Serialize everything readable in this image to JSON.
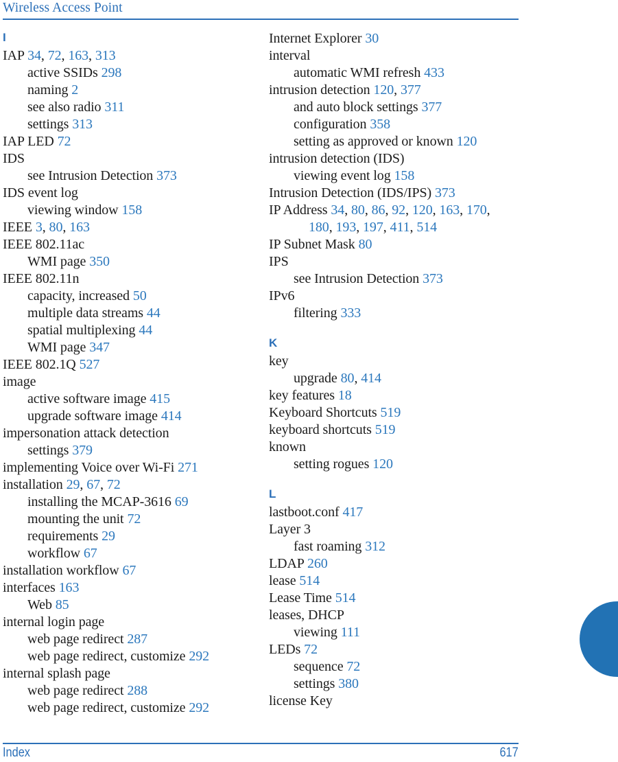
{
  "header": {
    "title": "Wireless Access Point"
  },
  "footer": {
    "label": "Index",
    "page_number": "617"
  },
  "colors": {
    "accent": "#2c70b8",
    "page_number": "#2c78bd",
    "body_text": "#1c1c1c",
    "thumb_tab": "#2272b4"
  },
  "columns": [
    {
      "name": "left-column",
      "sections": [
        {
          "letter": "I",
          "first": true,
          "entries": [
            {
              "level": 0,
              "text": "IAP",
              "pages": [
                "34",
                "72",
                "163",
                "313"
              ]
            },
            {
              "level": 1,
              "text": "active SSIDs",
              "pages": [
                "298"
              ]
            },
            {
              "level": 1,
              "text": "naming",
              "pages": [
                "2"
              ]
            },
            {
              "level": 1,
              "text": "see also radio",
              "pages": [
                "311"
              ]
            },
            {
              "level": 1,
              "text": "settings",
              "pages": [
                "313"
              ]
            },
            {
              "level": 0,
              "text": "IAP LED",
              "pages": [
                "72"
              ]
            },
            {
              "level": 0,
              "text": "IDS",
              "pages": []
            },
            {
              "level": 1,
              "text": "see Intrusion Detection",
              "pages": [
                "373"
              ]
            },
            {
              "level": 0,
              "text": "IDS event log",
              "pages": []
            },
            {
              "level": 1,
              "text": "viewing window",
              "pages": [
                "158"
              ]
            },
            {
              "level": 0,
              "text": "IEEE",
              "pages": [
                "3",
                "80",
                "163"
              ]
            },
            {
              "level": 0,
              "text": "IEEE 802.11ac",
              "pages": []
            },
            {
              "level": 1,
              "text": "WMI page",
              "pages": [
                "350"
              ]
            },
            {
              "level": 0,
              "text": "IEEE 802.11n",
              "pages": []
            },
            {
              "level": 1,
              "text": "capacity, increased",
              "pages": [
                "50"
              ]
            },
            {
              "level": 1,
              "text": "multiple data streams",
              "pages": [
                "44"
              ]
            },
            {
              "level": 1,
              "text": "spatial multiplexing",
              "pages": [
                "44"
              ]
            },
            {
              "level": 1,
              "text": "WMI page",
              "pages": [
                "347"
              ]
            },
            {
              "level": 0,
              "text": "IEEE 802.1Q",
              "pages": [
                "527"
              ]
            },
            {
              "level": 0,
              "text": "image",
              "pages": []
            },
            {
              "level": 1,
              "text": "active software image",
              "pages": [
                "415"
              ]
            },
            {
              "level": 1,
              "text": "upgrade software image",
              "pages": [
                "414"
              ]
            },
            {
              "level": 0,
              "text": "impersonation attack detection",
              "pages": []
            },
            {
              "level": 1,
              "text": "settings",
              "pages": [
                "379"
              ]
            },
            {
              "level": 0,
              "text": "implementing Voice over Wi-Fi",
              "pages": [
                "271"
              ]
            },
            {
              "level": 0,
              "text": "installation",
              "pages": [
                "29",
                "67",
                "72"
              ]
            },
            {
              "level": 1,
              "text": "installing the MCAP-3616",
              "pages": [
                "69"
              ]
            },
            {
              "level": 1,
              "text": "mounting the unit",
              "pages": [
                "72"
              ]
            },
            {
              "level": 1,
              "text": "requirements",
              "pages": [
                "29"
              ]
            },
            {
              "level": 1,
              "text": "workflow",
              "pages": [
                "67"
              ]
            },
            {
              "level": 0,
              "text": "installation workflow",
              "pages": [
                "67"
              ]
            },
            {
              "level": 0,
              "text": "interfaces",
              "pages": [
                "163"
              ]
            },
            {
              "level": 1,
              "text": "Web",
              "pages": [
                "85"
              ]
            },
            {
              "level": 0,
              "text": "internal login page",
              "pages": []
            },
            {
              "level": 1,
              "text": "web page redirect",
              "pages": [
                "287"
              ]
            },
            {
              "level": 1,
              "text": "web page redirect, customize",
              "pages": [
                "292"
              ]
            },
            {
              "level": 0,
              "text": "internal splash page",
              "pages": []
            },
            {
              "level": 1,
              "text": "web page redirect",
              "pages": [
                "288"
              ]
            },
            {
              "level": 1,
              "text": "web page redirect, customize",
              "pages": [
                "292"
              ]
            }
          ]
        }
      ]
    },
    {
      "name": "right-column",
      "sections": [
        {
          "letter": "",
          "first": true,
          "entries": [
            {
              "level": 0,
              "text": "Internet Explorer",
              "pages": [
                "30"
              ]
            },
            {
              "level": 0,
              "text": "interval",
              "pages": []
            },
            {
              "level": 1,
              "text": "automatic WMI refresh",
              "pages": [
                "433"
              ]
            },
            {
              "level": 0,
              "text": "intrusion detection",
              "pages": [
                "120",
                "377"
              ]
            },
            {
              "level": 1,
              "text": "and auto block settings",
              "pages": [
                "377"
              ]
            },
            {
              "level": 1,
              "text": "configuration",
              "pages": [
                "358"
              ]
            },
            {
              "level": 1,
              "text": "setting as approved or known",
              "pages": [
                "120"
              ]
            },
            {
              "level": 0,
              "text": "intrusion detection (IDS)",
              "pages": []
            },
            {
              "level": 1,
              "text": "viewing event log",
              "pages": [
                "158"
              ]
            },
            {
              "level": 0,
              "text": "Intrusion Detection (IDS/IPS)",
              "pages": [
                "373"
              ]
            },
            {
              "level": 0,
              "text": "IP Address",
              "pages": [
                "34",
                "80",
                "86",
                "92",
                "120",
                "163",
                "170"
              ],
              "trailing_comma": true
            },
            {
              "level": 2,
              "text": "",
              "pages": [
                "180",
                "193",
                "197",
                "411",
                "514"
              ]
            },
            {
              "level": 0,
              "text": "IP Subnet Mask",
              "pages": [
                "80"
              ]
            },
            {
              "level": 0,
              "text": "IPS",
              "pages": []
            },
            {
              "level": 1,
              "text": "see Intrusion Detection",
              "pages": [
                "373"
              ]
            },
            {
              "level": 0,
              "text": "IPv6",
              "pages": []
            },
            {
              "level": 1,
              "text": "filtering",
              "pages": [
                "333"
              ]
            }
          ]
        },
        {
          "letter": "K",
          "first": false,
          "entries": [
            {
              "level": 0,
              "text": "key",
              "pages": []
            },
            {
              "level": 1,
              "text": "upgrade",
              "pages": [
                "80",
                "414"
              ]
            },
            {
              "level": 0,
              "text": "key features",
              "pages": [
                "18"
              ]
            },
            {
              "level": 0,
              "text": "Keyboard Shortcuts",
              "pages": [
                "519"
              ]
            },
            {
              "level": 0,
              "text": "keyboard shortcuts",
              "pages": [
                "519"
              ]
            },
            {
              "level": 0,
              "text": "known",
              "pages": []
            },
            {
              "level": 1,
              "text": "setting rogues",
              "pages": [
                "120"
              ]
            }
          ]
        },
        {
          "letter": "L",
          "first": false,
          "entries": [
            {
              "level": 0,
              "text": "lastboot.conf",
              "pages": [
                "417"
              ]
            },
            {
              "level": 0,
              "text": "Layer 3",
              "pages": []
            },
            {
              "level": 1,
              "text": "fast roaming",
              "pages": [
                "312"
              ]
            },
            {
              "level": 0,
              "text": "LDAP",
              "pages": [
                "260"
              ]
            },
            {
              "level": 0,
              "text": "lease",
              "pages": [
                "514"
              ]
            },
            {
              "level": 0,
              "text": "Lease Time",
              "pages": [
                "514"
              ]
            },
            {
              "level": 0,
              "text": "leases, DHCP",
              "pages": []
            },
            {
              "level": 1,
              "text": "viewing",
              "pages": [
                "111"
              ]
            },
            {
              "level": 0,
              "text": "LEDs",
              "pages": [
                "72"
              ]
            },
            {
              "level": 1,
              "text": "sequence",
              "pages": [
                "72"
              ]
            },
            {
              "level": 1,
              "text": "settings",
              "pages": [
                "380"
              ]
            },
            {
              "level": 0,
              "text": "license Key",
              "pages": []
            }
          ]
        }
      ]
    }
  ]
}
